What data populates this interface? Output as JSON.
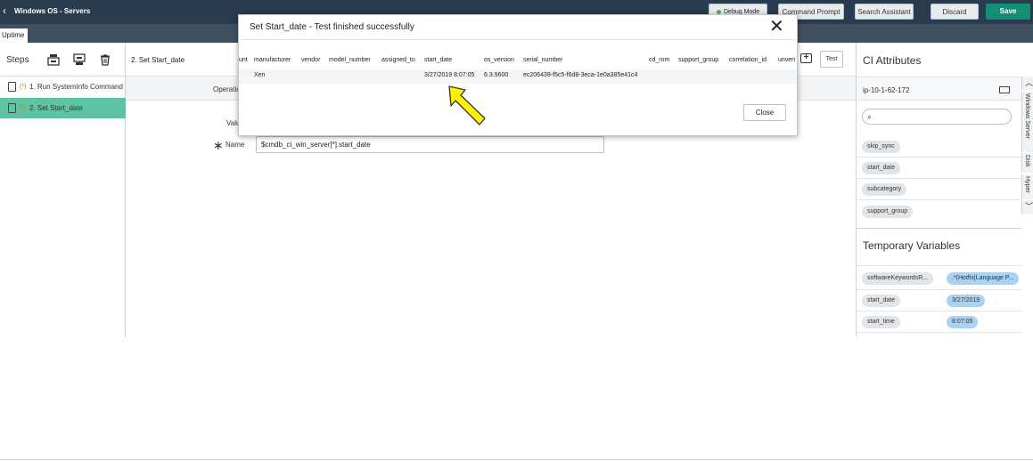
{
  "header": {
    "title": "Windows OS - Servers",
    "debug_mode": "Debug Mode",
    "command_prompt": "Command Prompt",
    "search_assistant": "Search Assistant",
    "discard": "Discard",
    "save": "Save"
  },
  "tabs": [
    {
      "label": "Uptime"
    }
  ],
  "steps_panel": {
    "label": "Steps",
    "items": [
      {
        "label": "1. Run SystemInfo Command",
        "active": false
      },
      {
        "label": "2. Set Start_date",
        "active": true
      }
    ]
  },
  "main": {
    "step_title": "2. Set Start_date",
    "test_label": "Test",
    "operation_label": "Operatic",
    "value_label": "Valu",
    "name_label": "Name",
    "name_value": "$cmdb_ci_win_server[*].start_date"
  },
  "right_panel": {
    "ci_attributes_title": "CI Attributes",
    "ci_name": "ip-10-1-62-172",
    "attributes": [
      "skip_sync",
      "start_date",
      "subcategory",
      "support_group"
    ],
    "temp_vars_title": "Temporary Variables",
    "temp_vars": [
      {
        "name": "softwareKeywordsR...",
        "value": ".*(Hotfix|Language P..."
      },
      {
        "name": "start_date",
        "value": "3/27/2019"
      },
      {
        "name": "start_time",
        "value": "8:07:05"
      }
    ],
    "side_tabs": [
      "Windows Server",
      "Disk",
      "Hyper"
    ]
  },
  "modal": {
    "title": "Set Start_date - Test finished successfully",
    "columns": [
      "unt",
      "manufacturer",
      "vendor",
      "model_number",
      "assigned_to",
      "start_date",
      "os_version",
      "serial_number",
      "cd_rom",
      "support_group",
      "correlation_id",
      "unveri"
    ],
    "row": {
      "manufacturer": "Xen",
      "start_date": "3/27/2019 8:07:05",
      "os_version": "6.3.9600",
      "serial_number": "ec206439-f5c5-f6d8-3eca-1e0a385e41c4"
    },
    "close_label": "Close"
  },
  "colors": {
    "header_bg": "#283b4f",
    "tab_bar_bg": "#40505e",
    "save_green": "#148e74",
    "active_step": "#5ec3a3",
    "highlight_arrow": "#fff200",
    "temp_value_pill": "#a9d3f5"
  }
}
